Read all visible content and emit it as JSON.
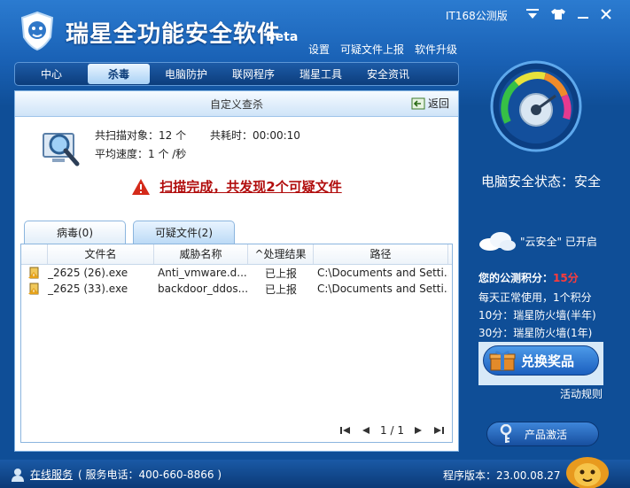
{
  "app": {
    "title": "瑞星全功能安全软件",
    "beta": "Beta",
    "edition": "IT168公测版"
  },
  "top_links": [
    "设置",
    "可疑文件上报",
    "软件升级"
  ],
  "nav": [
    {
      "label": "中心",
      "active": false
    },
    {
      "label": "杀毒",
      "active": true
    },
    {
      "label": "电脑防护",
      "active": false
    },
    {
      "label": "联网程序",
      "active": false
    },
    {
      "label": "瑞星工具",
      "active": false
    },
    {
      "label": "安全资讯",
      "active": false
    }
  ],
  "panel": {
    "title": "自定义查杀",
    "back": "返回",
    "scan_objects": "共扫描对象：12 个",
    "elapsed": "共耗时：00:00:10",
    "speed": "平均速度：1 个 /秒",
    "result": "扫描完成，共发现2个可疑文件"
  },
  "tabs": [
    {
      "label": "病毒(0)",
      "active": false
    },
    {
      "label": "可疑文件(2)",
      "active": true
    }
  ],
  "table": {
    "columns": [
      "文件名",
      "威胁名称",
      "处理结果",
      "路径"
    ],
    "rows": [
      {
        "file": "_2625 (26).exe",
        "threat": "Anti_vmware.d...",
        "result": "已上报",
        "path": "C:\\Documents and Setti..."
      },
      {
        "file": "_2625 (33).exe",
        "threat": "backdoor_ddos...",
        "result": "已上报",
        "path": "C:\\Documents and Setti..."
      }
    ],
    "page": "1 / 1"
  },
  "right": {
    "status": "电脑安全状态：安全",
    "cloud": "\"云安全\" 已开启",
    "points_label": "您的公测积分：",
    "points_value": "15分",
    "rules": [
      "每天正常使用，1个积分",
      "10分：瑞星防火墙(半年)",
      "30分：瑞星防火墙(1年)"
    ],
    "redeem": "兑换奖品",
    "activity_rules": "活动规则",
    "activate": "产品激活"
  },
  "footer": {
    "online": "在线服务",
    "phone": "( 服务电话：400-660-8866 )",
    "version": "程序版本：23.00.08.27"
  }
}
